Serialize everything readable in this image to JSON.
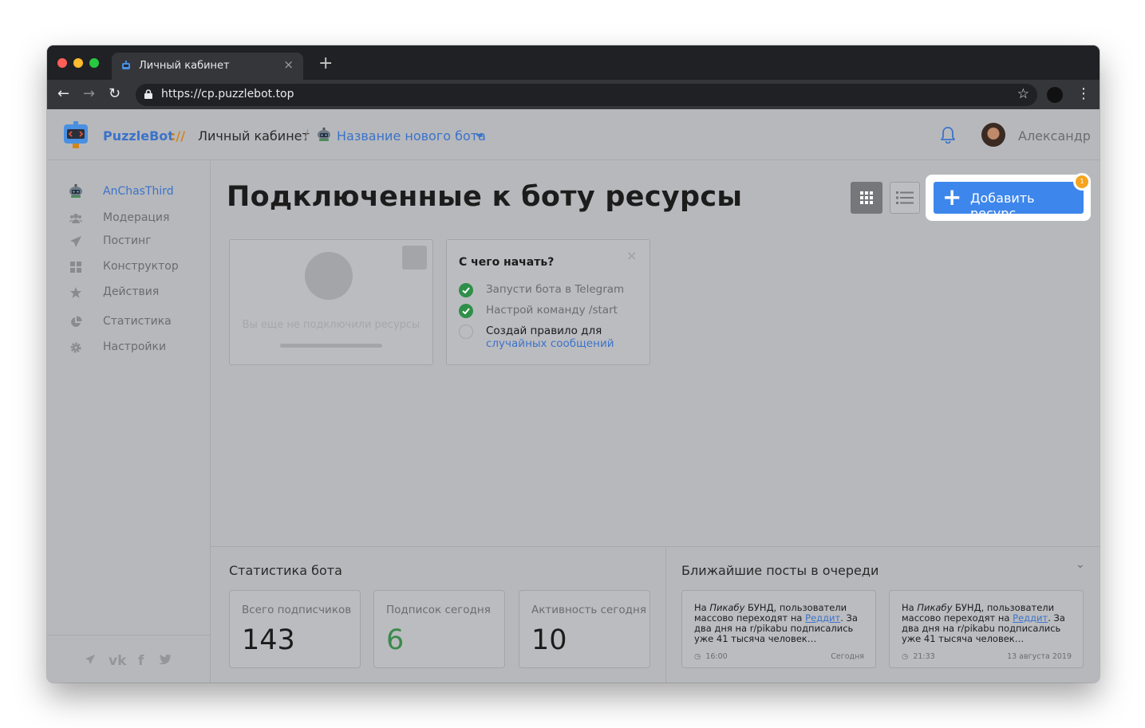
{
  "browser": {
    "tab_title": "Личный кабинет",
    "url": "https://cp.puzzlebot.top"
  },
  "header": {
    "brand": "PuzzleBot",
    "brand_sep": "://",
    "cabinet": "Личный кабинет",
    "slash": "/",
    "bot_name": "Название нового бота",
    "user_name": "Александр"
  },
  "sidebar": {
    "items": [
      {
        "label": "AnChasThird",
        "icon": "robot-icon"
      },
      {
        "label": "Модерация",
        "icon": "users-icon"
      },
      {
        "label": "Постинг",
        "icon": "paper-plane-icon"
      },
      {
        "label": "Конструктор",
        "icon": "grid-icon"
      },
      {
        "label": "Действия",
        "icon": "star-icon"
      },
      {
        "label": "Статистика",
        "icon": "pie-chart-icon"
      },
      {
        "label": "Настройки",
        "icon": "gear-icon"
      }
    ],
    "social": [
      "telegram-icon",
      "vk-icon",
      "facebook-icon",
      "twitter-icon"
    ]
  },
  "main": {
    "title": "Подключенные к боту ресурсы",
    "add_button": "Добавить ресурс",
    "add_badge": "1",
    "empty_text": "Вы еще не подключили ресурсы",
    "start": {
      "title": "С чего начать?",
      "close": "×",
      "items": [
        {
          "text": "Запусти бота в Telegram",
          "done": true
        },
        {
          "text": "Настрой команду /start",
          "done": true
        },
        {
          "text": "Создай правило для",
          "link": "случайных сообщений",
          "done": false
        }
      ]
    }
  },
  "stats": {
    "title": "Статистика бота",
    "cards": [
      {
        "label": "Всего подписчиков",
        "value": "143"
      },
      {
        "label": "Подписок сегодня",
        "value": "6"
      },
      {
        "label": "Активность сегодня",
        "value": "10"
      }
    ]
  },
  "posts": {
    "title": "Ближайшие посты в очереди",
    "items": [
      {
        "pre": "На ",
        "italic": "Пикабу",
        "mid": " БУНД, пользователи массово переходят на ",
        "link": "Реддит",
        "post": ". За два дня на r/pikabu подписались уже 41 тысяча человек…",
        "time": "16:00",
        "date": "Сегодня"
      },
      {
        "pre": "На ",
        "italic": "Пикабу",
        "mid": " БУНД, пользователи массово переходят на ",
        "link": "Реддит",
        "post": ". За два дня на r/pikabu подписались уже 41 тысяча человек…",
        "time": "21:33",
        "date": "13 августа 2019"
      }
    ]
  },
  "colors": {
    "accent": "#3d86ec",
    "link": "#3b73c9",
    "badge": "#f6a41d",
    "success": "#2e8f49"
  }
}
